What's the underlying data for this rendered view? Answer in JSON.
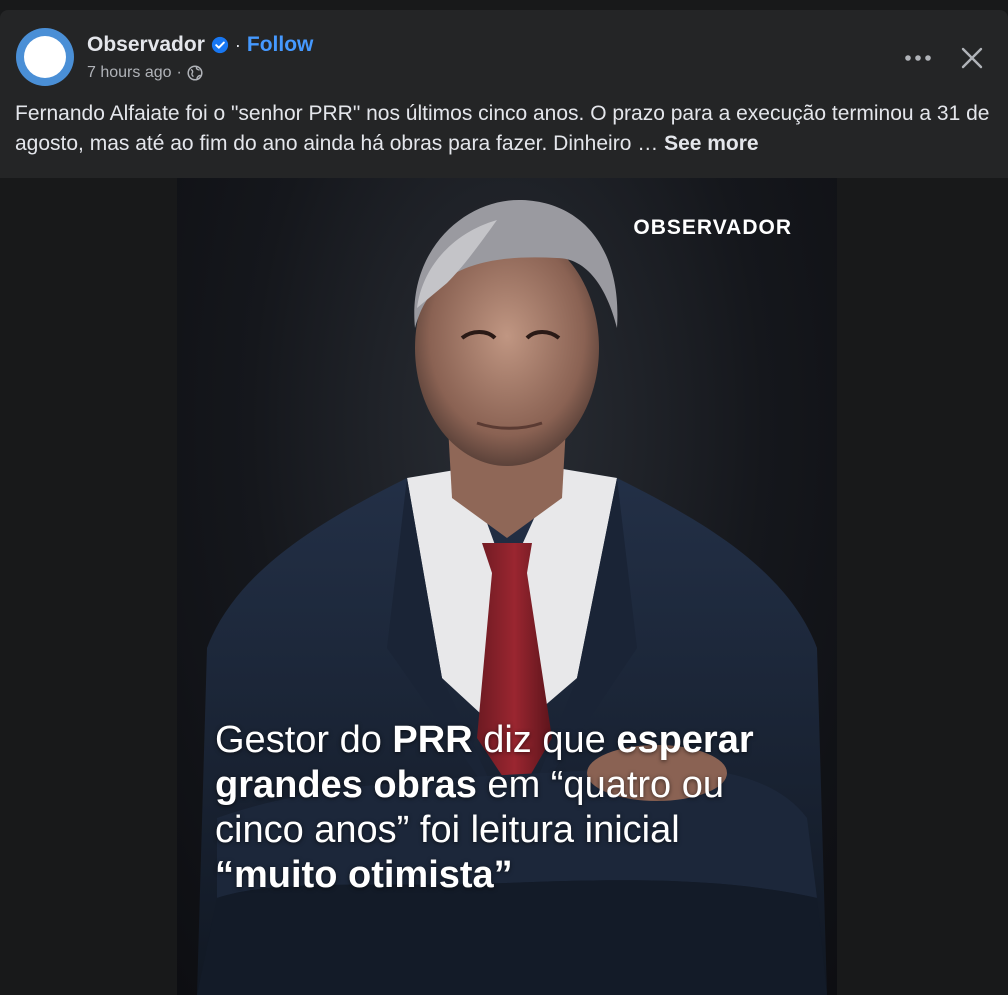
{
  "post": {
    "page_name": "Observador",
    "separator": "·",
    "follow_label": "Follow",
    "timestamp": "7 hours ago",
    "meta_separator": "·",
    "caption_text": "Fernando Alfaiate foi o \"senhor PRR\" nos últimos cinco anos. O prazo para a execução terminou a 31 de agosto, mas até ao fim do ano ainda há obras para fazer. Dinheiro … ",
    "see_more_label": "See more"
  },
  "media": {
    "brand_logo_text": "OBSERVADOR",
    "headline": {
      "p1": "Gestor do ",
      "p2": "PRR",
      "p3": " diz que ",
      "p4": "esperar",
      "p5": "grandes obras",
      "p6": " em “quatro ou",
      "p7": "cinco anos” foi leitura inicial",
      "p8": "“muito otimista”"
    }
  },
  "icons": {
    "verified": "verified-badge-icon",
    "globe": "globe-icon",
    "more": "more-options-icon",
    "close": "close-icon"
  },
  "colors": {
    "background": "#18191a",
    "card": "#242526",
    "text_primary": "#e4e6eb",
    "text_secondary": "#b0b3b8",
    "link": "#4599ff",
    "verified": "#1877f2"
  }
}
